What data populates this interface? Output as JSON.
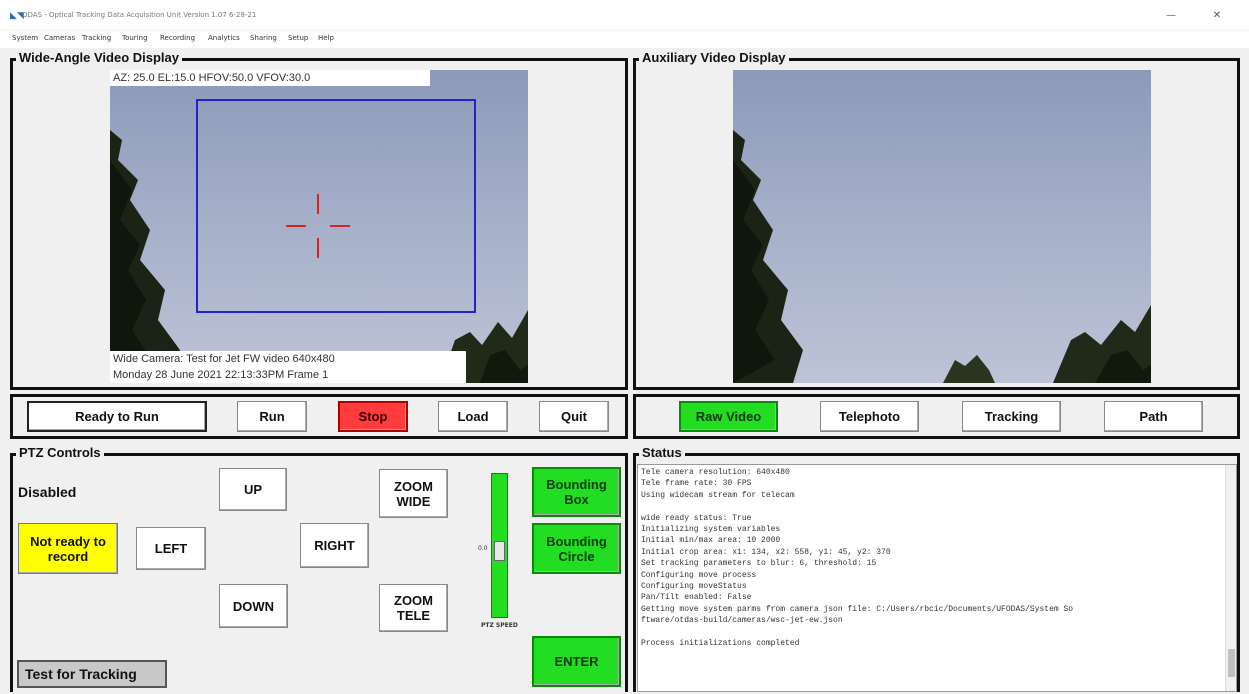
{
  "window": {
    "title": "ODAS - Optical Tracking Data Acquisition Unit   Version 1.07 6-28-21",
    "minimize": "—",
    "close": "✕"
  },
  "menu": [
    "System",
    "Cameras",
    "Tracking",
    "Touring",
    "Recording",
    "Analytics",
    "Sharing",
    "Setup",
    "Help"
  ],
  "wide": {
    "label": "Wide-Angle Video Display",
    "overlay_top": "AZ: 25.0   EL:15.0     HFOV:50.0   VFOV:30.0",
    "overlay_bottom_1": "Wide Camera: Test for Jet FW video   640x480",
    "overlay_bottom_2": "Monday 28 June 2021 22:13:33PM       Frame 1"
  },
  "aux": {
    "label": "Auxiliary Video Display"
  },
  "controls": {
    "ready": "Ready to Run",
    "run": "Run",
    "stop": "Stop",
    "load": "Load",
    "quit": "Quit"
  },
  "aux_controls": {
    "raw": "Raw Video",
    "tele": "Telephoto",
    "tracking": "Tracking",
    "path": "Path"
  },
  "ptz": {
    "label": "PTZ Controls",
    "state": "Disabled",
    "record": "Not ready to record",
    "up": "UP",
    "left": "LEFT",
    "right": "RIGHT",
    "down": "DOWN",
    "zoom_wide": "ZOOM WIDE",
    "zoom_tele": "ZOOM TELE",
    "slider_value": "0.0",
    "speed_label": "PTZ SPEED",
    "bounding_box": "Bounding Box",
    "bounding_circle": "Bounding Circle",
    "enter": "ENTER",
    "test": "Test for Tracking"
  },
  "status": {
    "label": "Status",
    "lines": [
      "Tele camera resolution: 640x480",
      "Tele frame rate: 30 FPS",
      "Using widecam stream for telecam",
      "",
      "wide ready status: True",
      "Initializing system variables",
      "Initial min/max area: 10  2000",
      "Initial crop area: x1: 134, x2: 558, y1: 45, y2: 370",
      "Set tracking parameters to blur: 6, threshold: 15",
      "Configuring move process",
      "Configuring moveStatus",
      "Pan/Tilt enabled: False",
      "Getting move system parms from camera json file: C:/Users/rbcic/Documents/UFODAS/System So",
      "ftware/otdas-build/cameras/wsc-jet-ew.json",
      "",
      "Process initializations completed"
    ]
  },
  "colors": {
    "green_button": "#22dd22",
    "stop_red": "#ff3b3b",
    "record_yellow": "#ffff00",
    "track_box": "#2222cc",
    "reticle": "#e02020"
  }
}
